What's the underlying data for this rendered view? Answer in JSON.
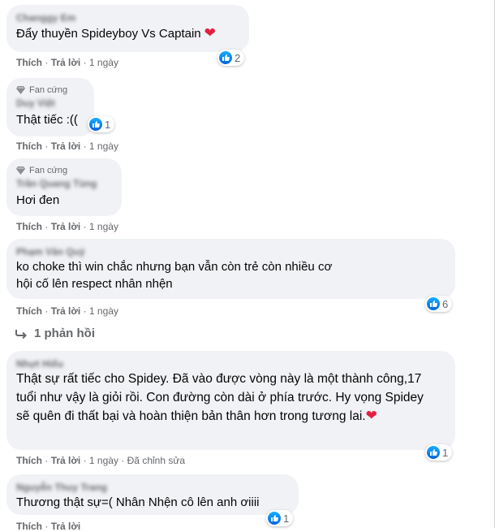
{
  "badge_label": "Fan cứng",
  "like_label": "Thích",
  "reply_label": "Trả lời",
  "dot": "·",
  "comments": [
    {
      "name": "Changgy Em",
      "text": "Đẩy thuyền Spideyboy Vs Captain",
      "time": "1 ngày",
      "reactions": "2",
      "heart": true
    },
    {
      "name": "Duy Việt",
      "text": "Thật tiếc :((",
      "time": "1 ngày",
      "reactions": "1",
      "badge": true
    },
    {
      "name": "Trần Quang Tùng",
      "text": "Hơi đen",
      "time": "1 ngày",
      "badge": true
    },
    {
      "name": "Phạm Văn Quý",
      "text": "ko choke thì win chắc nhưng bạn vẫn còn trẻ còn nhiều cơ hội cố lên respect nhân nhện",
      "time": "1 ngày",
      "reactions": "6",
      "reply_count": "1 phản hồi"
    },
    {
      "name": "Nhựt Hiếu",
      "text": "Thật sự rất tiếc cho Spidey. Đã vào được vòng này là một thành công,17 tuổi như vậy là giỏi rồi. Con đường còn dài ở phía trước. Hy vọng Spidey sẽ quên đi thất bại và hoàn thiện bản thân hơn trong tương lai.",
      "time": "1 ngày",
      "reactions": "1",
      "heart": true,
      "edited": "Đã chỉnh sửa"
    },
    {
      "name": "Nguyễn Thuy Trang",
      "text": "Thương thật sự=( Nhân Nhện cô lên anh ơiiii",
      "reactions": "1"
    }
  ]
}
